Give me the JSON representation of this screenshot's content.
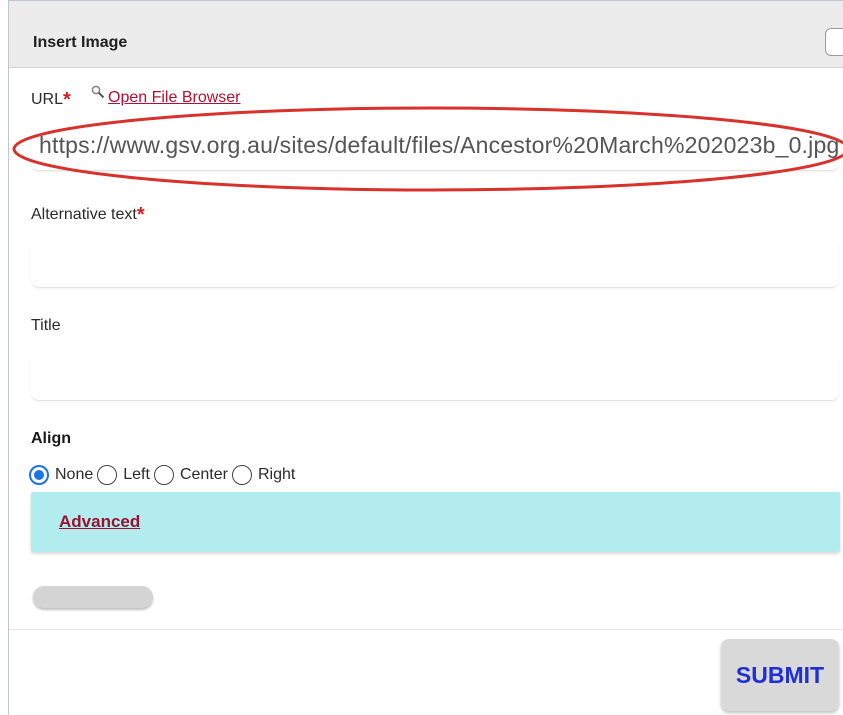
{
  "dialog": {
    "title": "Insert Image"
  },
  "url": {
    "label": "URL",
    "required_mark": "*",
    "browse_link": "Open File Browser",
    "value": "https://www.gsv.org.au/sites/default/files/Ancestor%20March%202023b_0.jpg"
  },
  "alt_text": {
    "label": "Alternative text",
    "required_mark": "*",
    "value": ""
  },
  "title_field": {
    "label": "Title",
    "value": ""
  },
  "align": {
    "label": "Align",
    "options": [
      {
        "label": "None",
        "checked": true
      },
      {
        "label": "Left",
        "checked": false
      },
      {
        "label": "Center",
        "checked": false
      },
      {
        "label": "Right",
        "checked": false
      }
    ]
  },
  "advanced": {
    "label": "Advanced"
  },
  "footer": {
    "submit_label": "SUBMIT"
  },
  "colors": {
    "highlight_ellipse": "#d9312b",
    "advanced_bg": "#b2ecee",
    "link": "#b21035",
    "submit_text": "#1e2fd6",
    "radio_selected": "#1a73e8"
  },
  "icons": [
    "search-icon",
    "close-icon"
  ]
}
